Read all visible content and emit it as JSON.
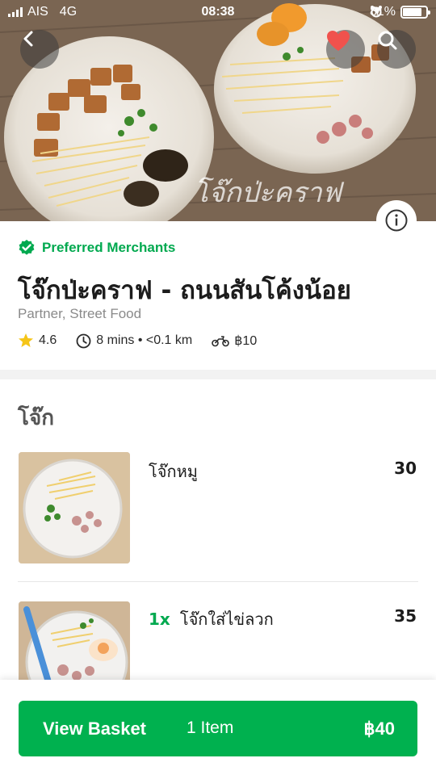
{
  "status_bar": {
    "carrier": "AIS",
    "network": "4G",
    "time": "08:38",
    "battery_percent": "81%",
    "battery_level": 0.81
  },
  "hero": {
    "watermark": "โจ๊กป่ะคราฟ",
    "favorite_color": "#f0524d",
    "favorited": true
  },
  "merchant": {
    "badge": "Preferred Merchants",
    "name": "โจ๊กป่ะคราฟ - ถนนสันโค้งน้อย",
    "category": "Partner, Street Food",
    "rating": "4.6",
    "delivery_time": "8 mins • <0.1 km",
    "delivery_fee": "฿10"
  },
  "menu": {
    "section": "โจ๊ก",
    "items": [
      {
        "quantity": "",
        "name": "โจ๊กหมู",
        "price": "30"
      },
      {
        "quantity": "1x",
        "name": "โจ๊กใส่ไข่ลวก",
        "price": "35"
      }
    ]
  },
  "basket": {
    "label": "View Basket",
    "count": "1 Item",
    "total": "฿40"
  },
  "colors": {
    "brand_green": "#00b14f",
    "badge_green": "#00a94f"
  },
  "icons": [
    "signal-icon",
    "alarm-icon",
    "location-icon",
    "battery-icon",
    "back-icon",
    "heart-icon",
    "search-icon",
    "info-icon",
    "verified-badge-icon",
    "star-icon",
    "clock-icon",
    "motorbike-icon"
  ]
}
